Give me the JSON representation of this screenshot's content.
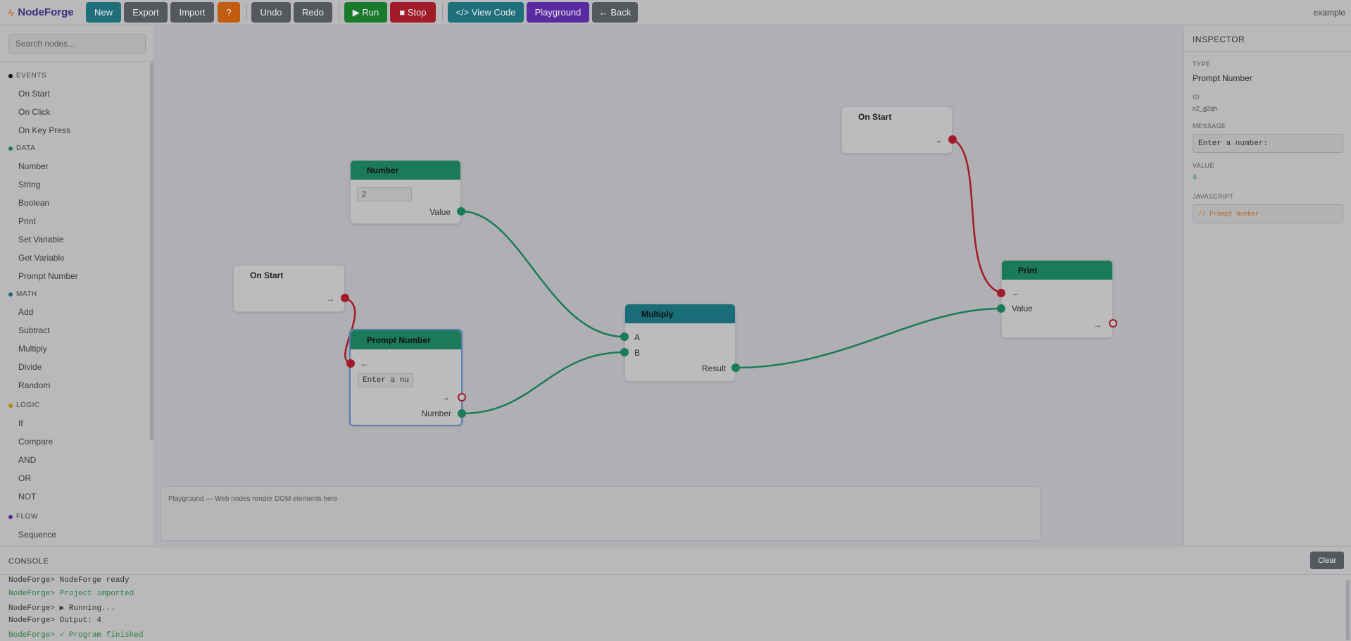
{
  "app": {
    "name": "NodeForge",
    "project": "example"
  },
  "toolbar": {
    "new": "New",
    "export": "Export",
    "import": "Import",
    "help": "?",
    "undo": "Undo",
    "redo": "Redo",
    "run": "▶ Run",
    "stop": "■ Stop",
    "view_code": "</> View Code",
    "playground": "Playground",
    "back": "← Back"
  },
  "sidebar": {
    "search_placeholder": "Search nodes...",
    "categories": [
      {
        "label": "EVENTS",
        "color": "#111111",
        "items": [
          "On Start",
          "On Click",
          "On Key Press"
        ]
      },
      {
        "label": "DATA",
        "color": "#1b7a57",
        "items": [
          "Number",
          "String",
          "Boolean",
          "Print",
          "Set Variable",
          "Get Variable",
          "Prompt Number"
        ]
      },
      {
        "label": "MATH",
        "color": "#1a6c79",
        "items": [
          "Add",
          "Subtract",
          "Multiply",
          "Divide",
          "Random"
        ]
      },
      {
        "label": "LOGIC",
        "color": "#b8860b",
        "items": [
          "If",
          "Compare",
          "AND",
          "OR",
          "NOT"
        ]
      },
      {
        "label": "FLOW",
        "color": "#5a2aa0",
        "items": [
          "Sequence"
        ]
      }
    ]
  },
  "nodes": {
    "number": {
      "title": "Number",
      "input_value": "2",
      "out": "Value"
    },
    "on_start_1": {
      "title": "On Start",
      "exec_out": "→"
    },
    "prompt": {
      "title": "Prompt Number",
      "exec_in": "←",
      "input_value": "Enter a nu",
      "exec_out": "→",
      "out": "Number"
    },
    "multiply": {
      "title": "Multiply",
      "in_a": "A",
      "in_b": "B",
      "out": "Result"
    },
    "on_start_2": {
      "title": "On Start",
      "exec_out": "→"
    },
    "print": {
      "title": "Print",
      "exec_in": "←",
      "in_value": "Value",
      "exec_out": "→"
    }
  },
  "playground": {
    "label": "Playground — Web nodes render DOM elements here"
  },
  "inspector": {
    "title": "INSPECTOR",
    "type_label": "TYPE",
    "type_value": "Prompt Number",
    "id_label": "ID",
    "id_value": "n2_g2qh",
    "message_label": "MESSAGE",
    "message_value": "Enter a number:",
    "value_label": "VALUE",
    "value_value": "4",
    "js_label": "JAVASCRIPT",
    "js_value": "// Prompt Number"
  },
  "console": {
    "title": "CONSOLE",
    "clear": "Clear",
    "lines": [
      {
        "text": "NodeForge> NodeForge ready",
        "green": false
      },
      {
        "text": "NodeForge> Project imported",
        "green": true
      },
      {
        "text": "NodeForge> ▶ Running...",
        "green": false
      },
      {
        "text": "NodeForge> Output: 4",
        "green": false
      },
      {
        "text": "NodeForge> ✓ Program finished",
        "green": true
      }
    ]
  },
  "colors": {
    "data_wire": "#1b7a57",
    "exec_wire": "#a11c28",
    "selected": "#5a7db4",
    "value_green": "#2b8a5a",
    "js_orange": "#b5651d"
  }
}
